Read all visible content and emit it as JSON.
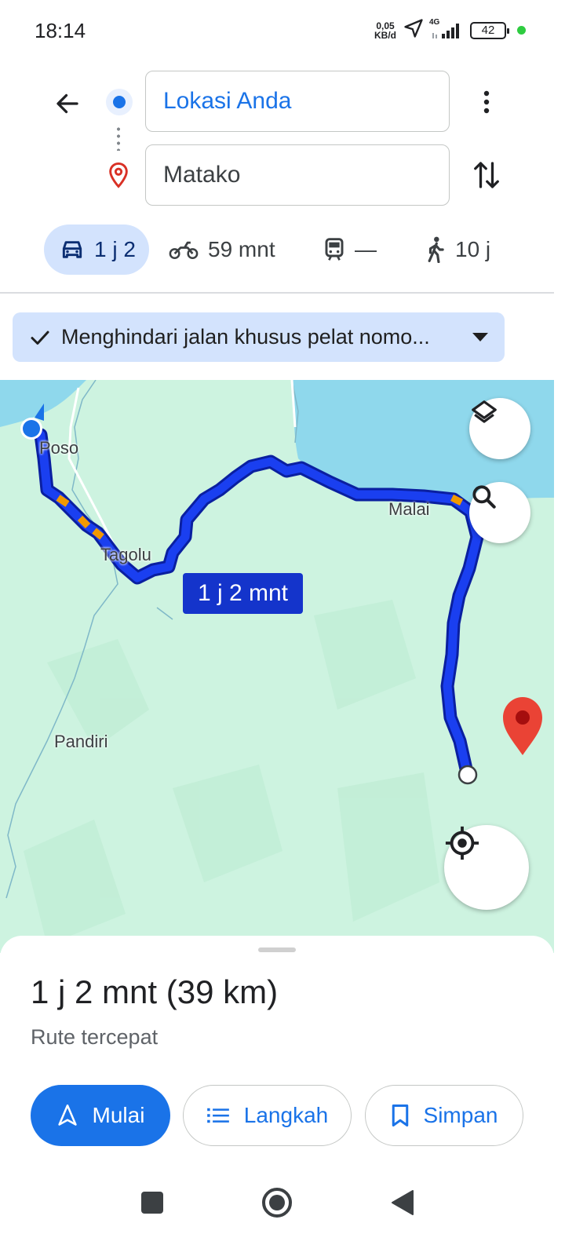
{
  "status_bar": {
    "time": "18:14",
    "net_speed_value": "0,05",
    "net_speed_unit": "KB/d",
    "network": "4G",
    "battery": "42"
  },
  "search": {
    "origin": "Lokasi Anda",
    "destination": "Matako"
  },
  "modes": [
    {
      "icon": "car-icon",
      "label": "1 j 2",
      "selected": true
    },
    {
      "icon": "motorcycle-icon",
      "label": "59 mnt"
    },
    {
      "icon": "transit-icon",
      "label": "—"
    },
    {
      "icon": "walk-icon",
      "label": "10 j"
    }
  ],
  "filter_chip": {
    "label": "Menghindari jalan khusus pelat nomo..."
  },
  "map": {
    "labels": {
      "poso": "Poso",
      "tagolu": "Tagolu",
      "malai": "Malai",
      "pandiri": "Pandiri"
    },
    "eta_bubble": "1 j 2 mnt",
    "route_color": "#1434cb",
    "traffic_color": "#f29900",
    "destination_color": "#ea4335"
  },
  "sheet": {
    "summary": "1 j 2 mnt (39 km)",
    "subtitle": "Rute tercepat",
    "start_label": "Mulai",
    "steps_label": "Langkah",
    "save_label": "Simpan"
  },
  "colors": {
    "accent": "#1a73e8",
    "chip_bg": "#d3e3fd",
    "map_land": "#cdf3e0",
    "map_water": "#8fd8ec"
  }
}
